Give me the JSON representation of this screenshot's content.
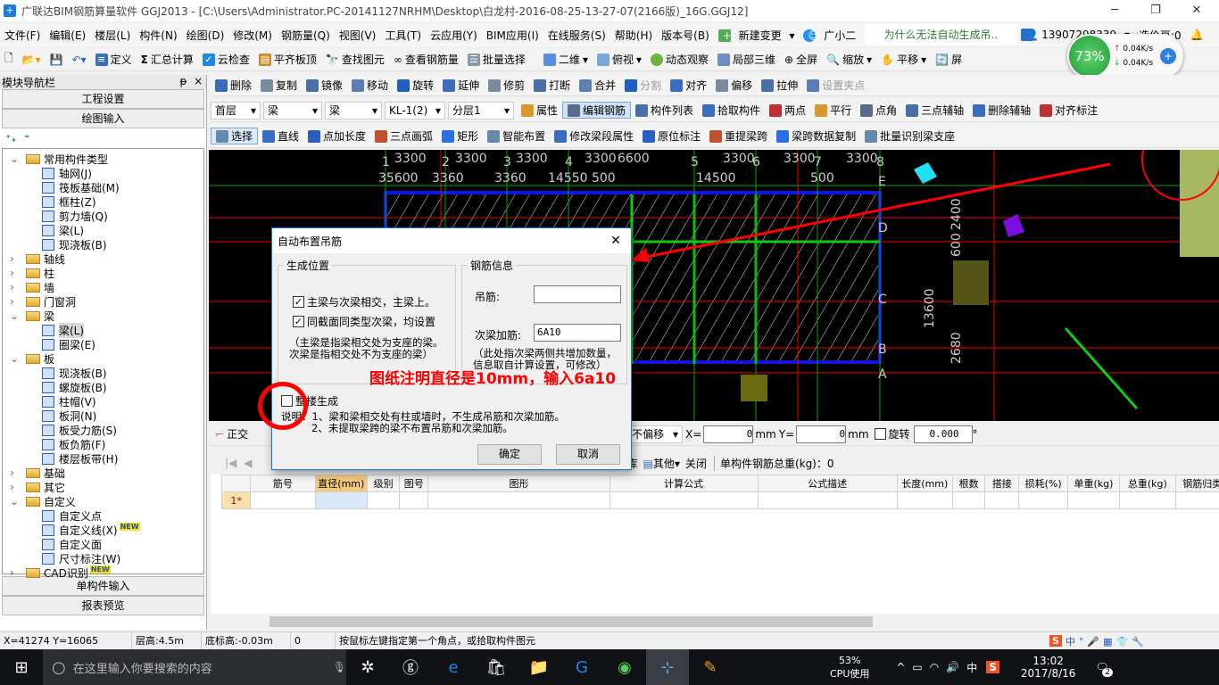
{
  "title": "广联达BIM钢筋算量软件 GGJ2013 - [C:\\Users\\Administrator.PC-20141127NRHM\\Desktop\\白龙村-2016-08-25-13-27-07(2166版)_16G.GGJ12]",
  "window_controls": [
    "─",
    "❐",
    "✕"
  ],
  "menu": [
    "文件(F)",
    "编辑(E)",
    "楼层(L)",
    "构件(N)",
    "绘图(D)",
    "修改(M)",
    "钢筋量(Q)",
    "视图(V)",
    "工具(T)",
    "云应用(Y)",
    "BIM应用(I)",
    "在线服务(S)",
    "帮助(H)",
    "版本号(B)"
  ],
  "menu_extra": {
    "new_change": "新建变更",
    "assistant": "广小二",
    "question": "为什么无法自动生成吊..",
    "phone": "13907298339",
    "beans": "造价豆:0"
  },
  "network": {
    "percent": "73%",
    "up": "0.04K/s",
    "down": "0.04K/s"
  },
  "toolbar1": [
    "定义",
    "汇总计算",
    "云检查",
    "平齐板顶",
    "查找图元",
    "查看钢筋量",
    "批量选择"
  ],
  "toolbar1b": [
    "二维",
    "俯视",
    "动态观察",
    "局部三维",
    "全屏",
    "缩放",
    "平移",
    "屏"
  ],
  "toolbar_edit": [
    "删除",
    "复制",
    "镜像",
    "移动",
    "旋转",
    "延伸",
    "修剪",
    "打断",
    "合并",
    "分割",
    "对齐",
    "偏移",
    "拉伸",
    "设置夹点"
  ],
  "selectors": [
    "首层",
    "梁",
    "梁",
    "KL-1(2)",
    "分层1"
  ],
  "toolbar_prop": [
    "属性",
    "编辑钢筋",
    "构件列表",
    "拾取构件",
    "两点",
    "平行",
    "点角",
    "三点辅轴",
    "删除辅轴",
    "对齐标注"
  ],
  "toolbar_draw": [
    "选择",
    "直线",
    "点加长度",
    "三点画弧",
    "矩形",
    "智能布置",
    "修改梁段属性",
    "原位标注",
    "重提梁跨",
    "梁跨数据复制",
    "批量识别梁支座"
  ],
  "nav": {
    "title": "模块导航栏",
    "pin": "ᵽ",
    "close": "×",
    "project": "工程设置",
    "drawing": "绘图输入",
    "single": "单构件输入",
    "report": "报表预览",
    "tree": [
      {
        "label": "常用构件类型",
        "level": 0,
        "folder": true,
        "open": true
      },
      {
        "label": "轴网(J)",
        "level": 1
      },
      {
        "label": "筏板基础(M)",
        "level": 1
      },
      {
        "label": "框柱(Z)",
        "level": 1
      },
      {
        "label": "剪力墙(Q)",
        "level": 1
      },
      {
        "label": "梁(L)",
        "level": 1
      },
      {
        "label": "现浇板(B)",
        "level": 1
      },
      {
        "label": "轴线",
        "level": 0,
        "folder": true
      },
      {
        "label": "柱",
        "level": 0,
        "folder": true
      },
      {
        "label": "墙",
        "level": 0,
        "folder": true
      },
      {
        "label": "门窗洞",
        "level": 0,
        "folder": true
      },
      {
        "label": "梁",
        "level": 0,
        "folder": true,
        "open": true
      },
      {
        "label": "梁(L)",
        "level": 1,
        "selected": true
      },
      {
        "label": "圈梁(E)",
        "level": 1
      },
      {
        "label": "板",
        "level": 0,
        "folder": true,
        "open": true
      },
      {
        "label": "现浇板(B)",
        "level": 1
      },
      {
        "label": "螺旋板(B)",
        "level": 1
      },
      {
        "label": "柱帽(V)",
        "level": 1
      },
      {
        "label": "板洞(N)",
        "level": 1
      },
      {
        "label": "板受力筋(S)",
        "level": 1
      },
      {
        "label": "板负筋(F)",
        "level": 1
      },
      {
        "label": "楼层板带(H)",
        "level": 1
      },
      {
        "label": "基础",
        "level": 0,
        "folder": true
      },
      {
        "label": "其它",
        "level": 0,
        "folder": true
      },
      {
        "label": "自定义",
        "level": 0,
        "folder": true,
        "open": true
      },
      {
        "label": "自定义点",
        "level": 1
      },
      {
        "label": "自定义线(X)",
        "level": 1,
        "new": "NEW"
      },
      {
        "label": "自定义面",
        "level": 1
      },
      {
        "label": "尺寸标注(W)",
        "level": 1
      },
      {
        "label": "CAD识别",
        "level": 0,
        "folder": true,
        "new": "NEW"
      }
    ]
  },
  "canvas": {
    "top_axes": [
      "1",
      "2",
      "3",
      "4",
      "5",
      "6",
      "7",
      "8"
    ],
    "top_dims": [
      "3300",
      "3300",
      "3300",
      "3300",
      "6600",
      "3300",
      "3300",
      "3300"
    ],
    "sub_dims": [
      "35600",
      "3360",
      "3360",
      "14550 500",
      "14500",
      "500"
    ],
    "row_axes": [
      "E",
      "D",
      "C",
      "B",
      "A"
    ],
    "vert_dims": [
      "13600",
      "2680",
      "2400",
      "600"
    ],
    "annotation": "图纸注明直径是10mm，输入6a10"
  },
  "dialog": {
    "title": "自动布置吊筋",
    "close": "✕",
    "group1": "生成位置",
    "opt1": "主梁与次梁相交，主梁上。",
    "opt2": "同截面同类型次梁，均设置",
    "note1a": "（主梁是指梁相交处为支座的梁。",
    "note1b": "次梁是指相交处不为支座的梁）",
    "group2": "钢筋信息",
    "hanger_label": "吊筋:",
    "hanger_value": "",
    "secondary_label": "次梁加筋:",
    "secondary_value": "6A10",
    "note2a": "（此处指次梁两侧共增加数量，",
    "note2b": "信息取自计算设置，可修改）",
    "whole_building": "整楼生成",
    "explain1": "说明：1、梁和梁相交处有柱或墙时，不生成吊筋和次梁加筋。",
    "explain2": "2、未提取梁跨的梁不布置吊筋和次梁加筋。",
    "ok": "确定",
    "cancel": "取消"
  },
  "bottom_toolbar": {
    "ortho": "正交",
    "offset": "不偏移",
    "x_label": "X=",
    "x_value": "0",
    "y_label": "Y=",
    "y_value": "0",
    "unit": "mm",
    "rotate": "旋转",
    "rotate_value": "0.000",
    "deg": "°"
  },
  "rebar_toolbar": {
    "lib": "库",
    "other": "其他",
    "close": "关闭",
    "total": "单构件钢筋总重(kg)：0"
  },
  "table": {
    "headers": [
      "",
      "筋号",
      "直径(mm)",
      "级别",
      "图号",
      "图形",
      "计算公式",
      "公式描述",
      "长度(mm)",
      "根数",
      "搭接",
      "损耗(%)",
      "单重(kg)",
      "总重(kg)",
      "钢筋归类"
    ],
    "rows": [
      [
        "1*",
        "",
        "",
        "",
        "",
        "",
        "",
        "",
        "",
        "",
        "",
        "",
        "",
        "",
        ""
      ]
    ]
  },
  "status": {
    "coords": "X=41274 Y=16065",
    "floor_height": "层高:4.5m",
    "base_height": "底标高:-0.03m",
    "zero": "0",
    "hint": "按鼠标左键指定第一个角点，或拾取构件图元"
  },
  "taskbar": {
    "search": "在这里输入你要搜索的内容",
    "cpu": "53%",
    "cpu_label": "CPU使用",
    "ime": "中",
    "time": "13:02",
    "date": "2017/8/16",
    "notif": "2"
  },
  "colors": {
    "canvas": "#000000",
    "annotation": "#ff0000",
    "accent": "#1979ca"
  }
}
